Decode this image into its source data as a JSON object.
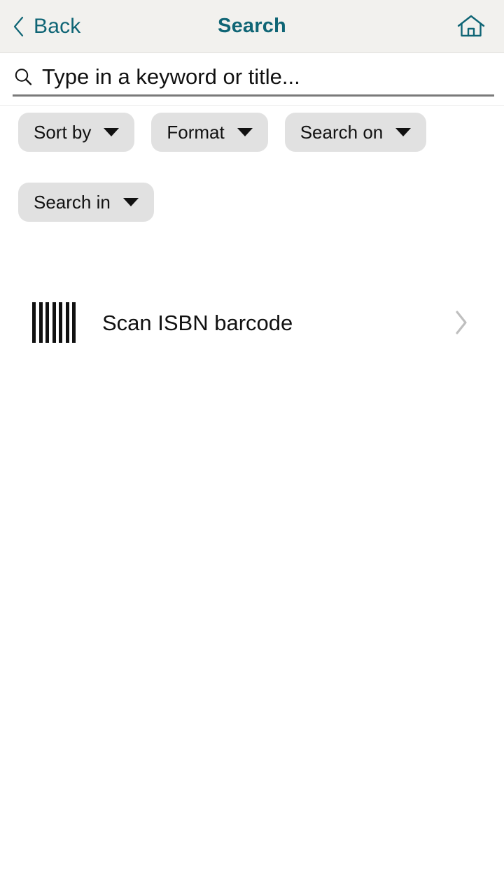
{
  "header": {
    "back_label": "Back",
    "title": "Search",
    "back_icon": "chevron-left-icon",
    "home_icon": "home-icon"
  },
  "search": {
    "icon": "search-icon",
    "value": "",
    "placeholder": "Type in a keyword or title..."
  },
  "filters": {
    "chips": [
      {
        "label": "Sort by",
        "icon": "caret-down-icon"
      },
      {
        "label": "Format",
        "icon": "caret-down-icon"
      },
      {
        "label": "Search on",
        "icon": "caret-down-icon"
      },
      {
        "label": "Search in",
        "icon": "caret-down-icon"
      }
    ]
  },
  "scan": {
    "label": "Scan ISBN barcode",
    "icon": "barcode-icon",
    "chevron": "chevron-right-icon",
    "bars": 7
  },
  "colors": {
    "accent_teal": "#0f6575",
    "header_bg": "#f2f1ee",
    "chip_bg": "#e1e1e1",
    "text": "#111111",
    "chevron_gray": "#bfbfbf",
    "underline": "#7a7a7a"
  }
}
